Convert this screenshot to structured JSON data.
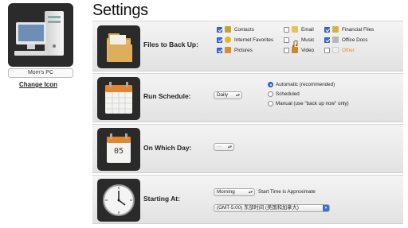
{
  "title": "Settings",
  "computer": {
    "name": "Mom's PC",
    "change_icon": "Change Icon"
  },
  "files": {
    "label": "Files to Back Up:",
    "items": [
      {
        "label": "Contacts",
        "checked": true,
        "icon": "contacts-icon",
        "color": "#c9a227"
      },
      {
        "label": "Internet Favorites",
        "checked": true,
        "icon": "star-icon",
        "color": "#e8b523"
      },
      {
        "label": "Pictures",
        "checked": true,
        "icon": "pictures-icon",
        "color": "#e08a2a"
      },
      {
        "label": "Email",
        "checked": false,
        "icon": "email-icon",
        "color": "#e9c44a"
      },
      {
        "label": "Music",
        "checked": false,
        "icon": "music-icon",
        "color": "#d8a43a"
      },
      {
        "label": "Video",
        "checked": false,
        "icon": "video-icon",
        "color": "#c9882c"
      },
      {
        "label": "Financial Files",
        "checked": true,
        "icon": "financial-icon",
        "color": "#d6b33a"
      },
      {
        "label": "Office Docs",
        "checked": true,
        "icon": "docs-icon",
        "color": "#b7b7b7"
      },
      {
        "label": "Other",
        "checked": false,
        "icon": "other-icon",
        "color": "#ededed",
        "muted": true
      }
    ]
  },
  "schedule": {
    "label": "Run Schedule:",
    "select_value": "Daily",
    "options": [
      {
        "label": "Automatic (recommended)",
        "selected": true
      },
      {
        "label": "Scheduled",
        "selected": false
      },
      {
        "label": "Manual (use \"back up now\" only)",
        "selected": false
      }
    ]
  },
  "day": {
    "label": "On Which Day:",
    "select_value": "---",
    "calendar_number": "05"
  },
  "start": {
    "label": "Starting At:",
    "time_value": "Morning",
    "time_note": "Start Time is Approximate",
    "timezone_value": "(GMT-5:00) 东部时间 (美国和加拿大)"
  },
  "colors": {
    "checkbox_blue": "#3a6fd8",
    "other_orange": "#e88a1a"
  }
}
